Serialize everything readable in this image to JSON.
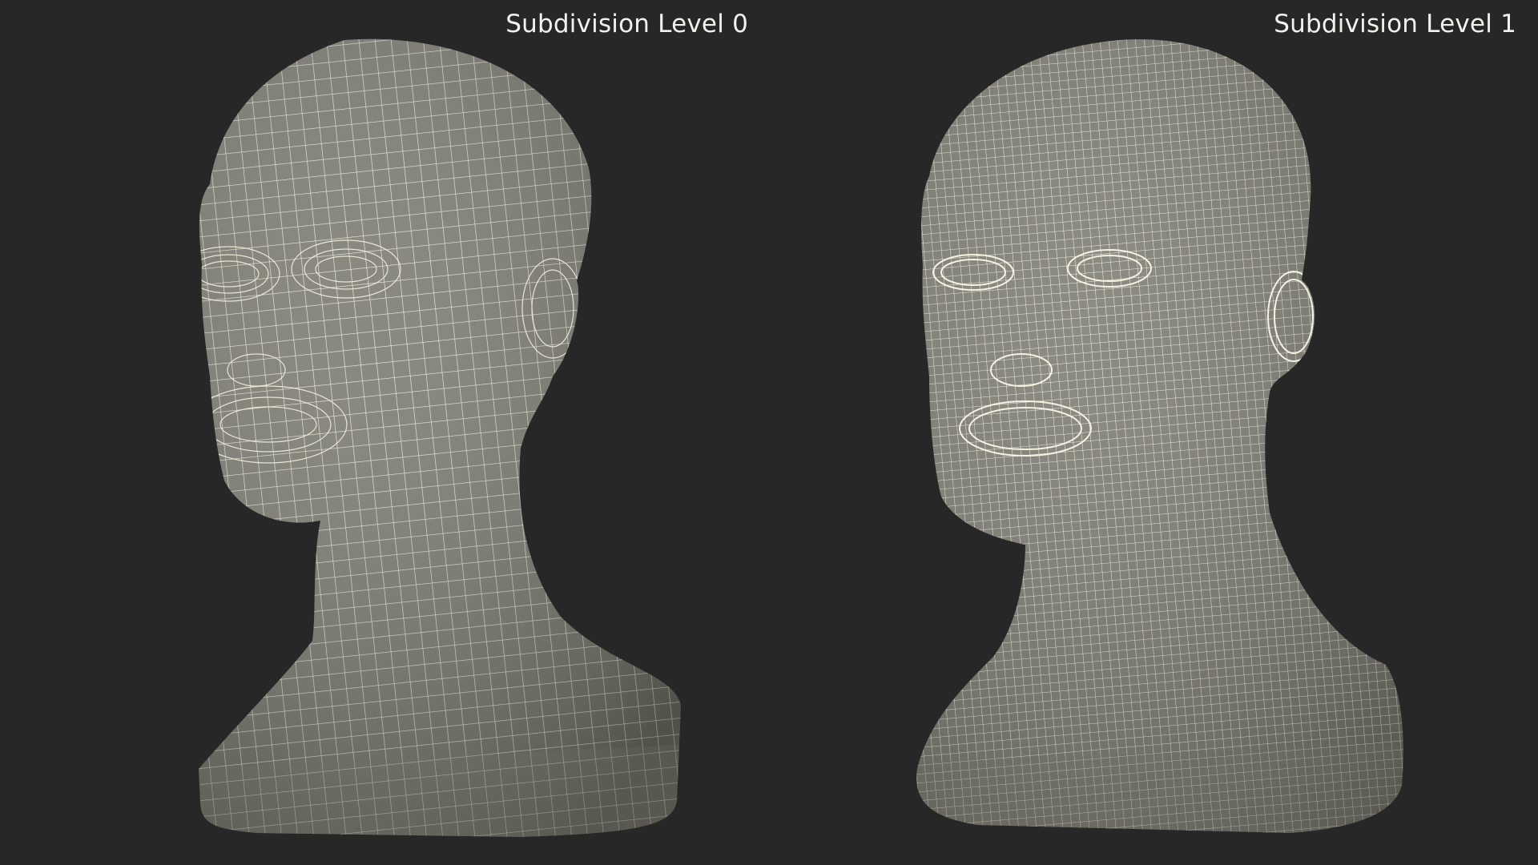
{
  "viewports": [
    {
      "label": "Subdivision Level 0",
      "mesh_density": "coarse"
    },
    {
      "label": "Subdivision Level 1",
      "mesh_density": "fine"
    }
  ],
  "colors": {
    "background": "#272727",
    "mesh_fill": "#7c7c72",
    "wire": "#f3f0df",
    "label_text": "#f1f1ee"
  }
}
